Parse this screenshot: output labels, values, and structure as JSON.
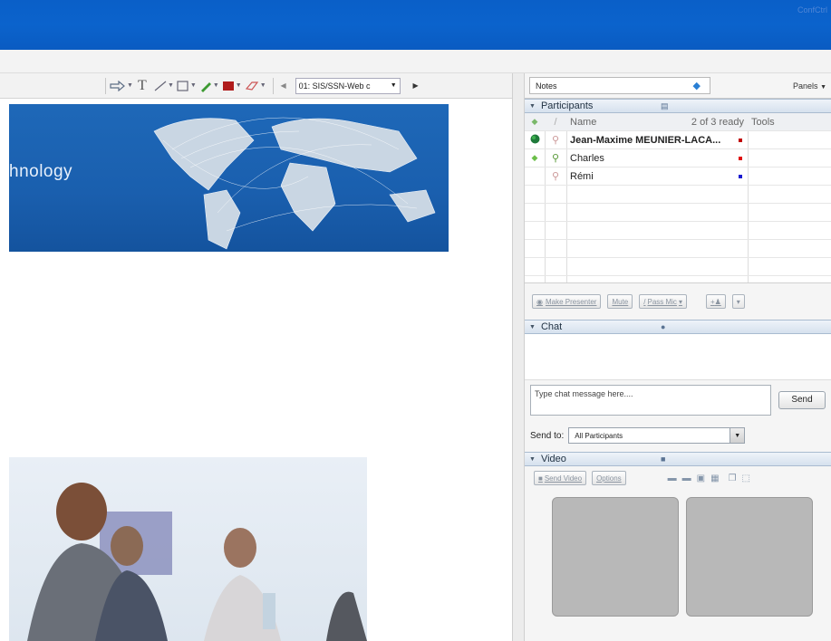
{
  "window": {
    "title_corner": "ConfCtrl"
  },
  "toolbar": {
    "icons": [
      "arrow-tool-icon",
      "text-tool-icon",
      "line-tool-icon",
      "rectangle-tool-icon",
      "pen-tool-icon",
      "color-tool-icon",
      "eraser-tool-icon",
      "prev-page-icon",
      "next-page-icon"
    ],
    "text_tool_label": "T",
    "slide_selector_value": "01: SIS/SSN-Web c",
    "colors": {
      "color_swatch": "#b01c1c"
    }
  },
  "slide": {
    "banner_text": "hnology"
  },
  "notes": {
    "label": "Notes",
    "panels_button": "Panels"
  },
  "participants": {
    "header": "Participants",
    "col_name": "Name",
    "ready_status": "2 of 3 ready",
    "col_tools": "Tools",
    "rows": [
      {
        "name": "Jean-Maxime MEUNIER-LACA...",
        "dot_color": "#c00000",
        "status_icon": "green-globe-icon",
        "bold": true
      },
      {
        "name": "Charles",
        "dot_color": "#e01010",
        "status_icon": "green-diamond-icon",
        "bold": false
      },
      {
        "name": "Rémi",
        "dot_color": "#1a1ad0",
        "status_icon": "",
        "bold": false
      }
    ],
    "buttons": {
      "make_presenter": "Make Presenter",
      "mute": "Mute",
      "pass_mic": "Pass Mic",
      "add": "+"
    }
  },
  "chat": {
    "header": "Chat",
    "input_placeholder": "Type chat message here....",
    "send": "Send",
    "send_to_label": "Send to:",
    "send_to_value": "All Participants"
  },
  "video": {
    "header": "Video",
    "send_video": "Send Video",
    "options": "Options"
  }
}
